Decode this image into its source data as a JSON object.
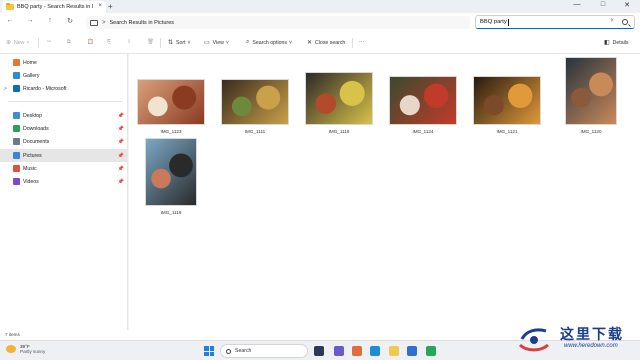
{
  "window": {
    "tab_title": "BBQ party - Search Results in I",
    "tab_close": "×",
    "new_tab": "+",
    "minimize": "—",
    "maximize": "□",
    "close": "✕"
  },
  "address": {
    "back": "←",
    "forward": "→",
    "up": "↑",
    "refresh": "↻",
    "breadcrumb_chevron": ">",
    "breadcrumb": "Search Results in Pictures",
    "search_query": "BBQ party",
    "search_clear": "×"
  },
  "toolbar": {
    "new_label": "New",
    "cut_icon": "✂",
    "copy_icon": "⧉",
    "paste_icon": "📋",
    "rename_icon": "⎘",
    "share_icon": "⇪",
    "delete_icon": "🗑",
    "sort_label": "Sort",
    "view_label": "View",
    "search_options_label": "Search options",
    "close_search_label": "Close search",
    "more": "···",
    "details_label": "Details"
  },
  "sidebar": {
    "items": [
      {
        "label": "Home",
        "icon": "home-icon",
        "color": "#e8743b",
        "pinned": false
      },
      {
        "label": "Gallery",
        "icon": "gallery-icon",
        "color": "#2c8dd6",
        "pinned": false
      },
      {
        "label": "Ricardo - Microsoft",
        "icon": "cloud-icon",
        "color": "#0f6cbd",
        "pinned": false
      },
      {
        "label": "Desktop",
        "icon": "desktop-icon",
        "color": "#3b8fd9",
        "pinned": true
      },
      {
        "label": "Downloads",
        "icon": "downloads-icon",
        "color": "#2e9e5b",
        "pinned": true
      },
      {
        "label": "Documents",
        "icon": "documents-icon",
        "color": "#6c7a89",
        "pinned": true
      },
      {
        "label": "Pictures",
        "icon": "pictures-icon",
        "color": "#3a86d4",
        "pinned": true
      },
      {
        "label": "Music",
        "icon": "music-icon",
        "color": "#e0503c",
        "pinned": true
      },
      {
        "label": "Videos",
        "icon": "videos-icon",
        "color": "#7b4bc9",
        "pinned": true
      }
    ],
    "pin_glyph": "📌",
    "expand_glyph": ">"
  },
  "files": [
    {
      "name": "IMG_1123",
      "colors": [
        "#d9a07a",
        "#8a3b22",
        "#f2e3d0"
      ]
    },
    {
      "name": "IMG_1111",
      "colors": [
        "#3b2a1e",
        "#c9a14a",
        "#6d8a3a"
      ]
    },
    {
      "name": "IMG_1116",
      "colors": [
        "#2d2a26",
        "#d8c24a",
        "#b24a2c"
      ]
    },
    {
      "name": "IMG_1124",
      "colors": [
        "#3a4a2e",
        "#c23b2a",
        "#e7d7c8"
      ]
    },
    {
      "name": "IMG_1121",
      "colors": [
        "#2a1a10",
        "#e09a3a",
        "#7a4a2a"
      ]
    },
    {
      "name": "IMG_1120",
      "colors": [
        "#27333d",
        "#c98a5a",
        "#8a5a3a"
      ]
    },
    {
      "name": "IMG_1119",
      "colors": [
        "#7aa8c7",
        "#2a2a2a",
        "#c97a5a"
      ]
    }
  ],
  "status": {
    "item_count": "7 items"
  },
  "taskbar": {
    "temperature": "39°F",
    "weather": "Partly sunny",
    "search_placeholder": "Search"
  },
  "watermark": {
    "chinese": "这里下载",
    "url": "www.heredown.com"
  }
}
